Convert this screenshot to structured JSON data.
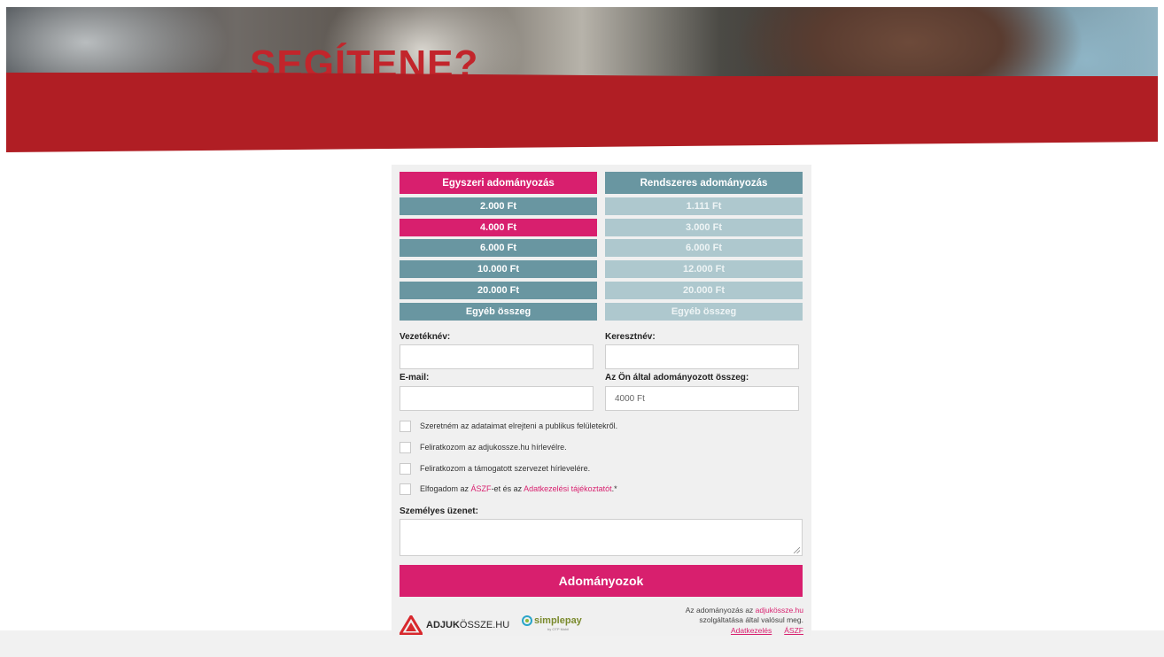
{
  "hero": {
    "title": "SEGÍTENE?"
  },
  "tabs": {
    "one_time": "Egyszeri adományozás",
    "recurring": "Rendszeres adományozás"
  },
  "one_time_amounts": [
    "2.000 Ft",
    "4.000 Ft",
    "6.000 Ft",
    "10.000 Ft",
    "20.000 Ft",
    "Egyéb összeg"
  ],
  "recurring_amounts": [
    "1.111 Ft",
    "3.000 Ft",
    "6.000 Ft",
    "12.000 Ft",
    "20.000 Ft",
    "Egyéb összeg"
  ],
  "selected_amount": "4.000 Ft",
  "form": {
    "last_name_label": "Vezetéknév:",
    "first_name_label": "Keresztnév:",
    "email_label": "E-mail:",
    "amount_label": "Az Ön által adományozott összeg:",
    "amount_value": "4000 Ft",
    "message_label": "Személyes üzenet:"
  },
  "checkboxes": {
    "hide_data": "Szeretném az adataimat elrejteni a publikus felületekről.",
    "subscribe_site": "Feliratkozom az adjukossze.hu hírlevélre.",
    "subscribe_org": "Feliratkozom a támogatott szervezet hírlevelére.",
    "accept_prefix": "Elfogadom az ",
    "accept_aszf": "ÁSZF",
    "accept_middle": "-et és az ",
    "accept_privacy": "Adatkezelési tájékoztatót",
    "accept_suffix": ".*"
  },
  "submit_label": "Adományozok",
  "footer": {
    "logo_bold": "ADJUK",
    "logo_rest": "ÖSSZE.HU",
    "simplepay_label": "simplepay",
    "simplepay_sub": "by OTP Mobil",
    "note_prefix": "Az adományozás az ",
    "note_link": "adjukössze.hu",
    "note_suffix": "szolgáltatása által valósul meg.",
    "link_privacy": "Adatkezelés",
    "link_aszf": "ÁSZF"
  },
  "colors": {
    "brand_pink": "#d81f6e",
    "teal": "#6996a1",
    "banner_red": "#b01e24"
  }
}
